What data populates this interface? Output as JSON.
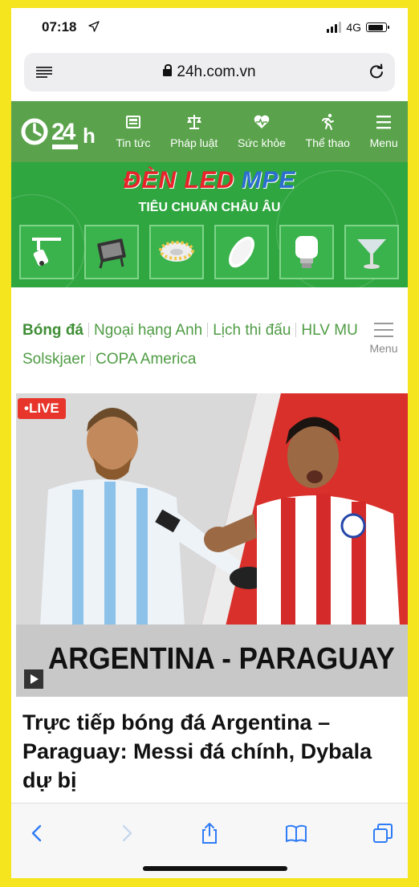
{
  "status_bar": {
    "time": "07:18",
    "network": "4G"
  },
  "browser": {
    "url": "24h.com.vn"
  },
  "site_nav": {
    "items": [
      {
        "label": "Tin tức",
        "icon": "news-icon"
      },
      {
        "label": "Pháp luật",
        "icon": "scales-icon"
      },
      {
        "label": "Sức khỏe",
        "icon": "health-heart-icon"
      },
      {
        "label": "Thể thao",
        "icon": "runner-icon"
      },
      {
        "label": "Menu",
        "icon": "hamburger-icon"
      }
    ]
  },
  "banner": {
    "title_part1": "ĐÈN LED",
    "title_part2": "MPE",
    "subtitle": "TIÊU CHUẨN CHÂU ÂU"
  },
  "category_nav": {
    "active": "Bóng đá",
    "links": [
      "Ngoại hạng Anh",
      "Lịch thi đấu",
      "HLV MU Solskjaer",
      "COPA America"
    ],
    "menu_label": "Menu"
  },
  "hero": {
    "live_label": "•LIVE",
    "caption": "ARGENTINA - PARAGUAY"
  },
  "article": {
    "headline": "Trực tiếp bóng đá Argentina – Paraguay: Messi đá chính, Dybala dự bị"
  },
  "colors": {
    "page_border": "#f5e51e",
    "header_green": "#5aa34c",
    "banner_green": "#2fa640",
    "link_green": "#4f9c44",
    "live_red": "#e8352b",
    "paraguay_red": "#d9302b"
  }
}
